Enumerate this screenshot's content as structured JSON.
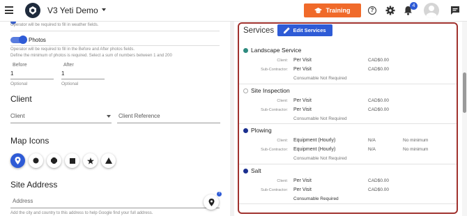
{
  "header": {
    "app_title": "V3 Yeti Demo",
    "training_label": "Training",
    "notification_count": "4"
  },
  "form": {
    "weather_note": "Operator will be required to fill in weather fields.",
    "photos_label": "Photos",
    "photos_note": "Operator will be required to fill in the Before and After photos fields.",
    "photos_min_note": "Define the minimum of photos is required. Select a sum of numbers between 1 and 200",
    "before_label": "Before",
    "before_value": "1",
    "before_hint": "Optional",
    "after_label": "After",
    "after_value": "1",
    "after_hint": "Optional",
    "client_title": "Client",
    "client_select": "Client",
    "client_reference": "Client Reference",
    "map_icons_title": "Map Icons",
    "site_address_title": "Site Address",
    "address_placeholder": "Address",
    "address_help": "Add the city and country to this address to help Google find your full address."
  },
  "services": {
    "title": "Services",
    "edit_label": "Edit Services",
    "client_label": "Client:",
    "sub_label": "Sub-Contractor:",
    "items": [
      {
        "name": "Landscape Service",
        "client_type": "Per Visit",
        "client_price": "CAD$0.00",
        "sub_type": "Per Visit",
        "sub_price": "CAD$0.00",
        "client_min": "",
        "sub_min": "",
        "consumable": "Consumable Not Required",
        "radio_color": "#2e8b7f"
      },
      {
        "name": "Site Inspection",
        "client_type": "Per Visit",
        "client_price": "CAD$0.00",
        "sub_type": "Per Visit",
        "sub_price": "CAD$0.00",
        "client_min": "",
        "sub_min": "",
        "consumable": "Consumable Not Required",
        "radio_color": "#ffffff"
      },
      {
        "name": "Plowing",
        "client_type": "Equipment (Hourly)",
        "client_price": "N/A",
        "sub_type": "Equipment (Hourly)",
        "sub_price": "N/A",
        "client_min": "No minimum",
        "sub_min": "No minimum",
        "consumable": "Consumable Not Required",
        "radio_color": "#1a2f8f"
      },
      {
        "name": "Salt",
        "client_type": "Per Visit",
        "client_price": "CAD$0.00",
        "sub_type": "Per Visit",
        "sub_price": "CAD$0.00",
        "client_min": "",
        "sub_min": "",
        "consumable": "Consumable Required",
        "radio_color": "#1a2f8f"
      }
    ]
  },
  "colors": {
    "accent_blue": "#2e5bd6",
    "training_orange": "#f06a2a",
    "highlight_border": "#a0322e"
  }
}
